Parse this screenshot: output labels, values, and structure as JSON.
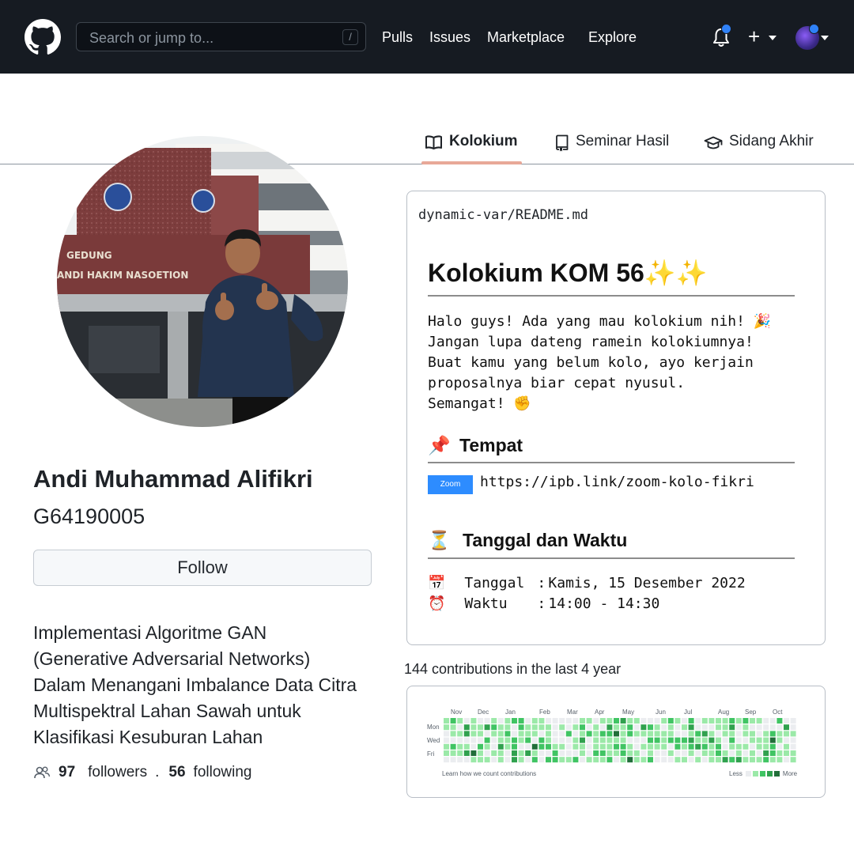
{
  "topbar": {
    "search_placeholder": "Search or jump to...",
    "search_shortcut": "/",
    "nav": [
      "Pulls",
      "Issues",
      "Marketplace",
      "Explore"
    ],
    "plus_label": "+",
    "colors": {
      "bg": "#161b22",
      "notification_dot": "#2f81f7"
    }
  },
  "tabs": [
    {
      "label": "Kolokium",
      "icon": "book-icon",
      "active": true
    },
    {
      "label": "Seminar Hasil",
      "icon": "repo-icon",
      "active": false
    },
    {
      "label": "Sidang Akhir",
      "icon": "mortarboard-icon",
      "active": false
    }
  ],
  "profile": {
    "name": "Andi Muhammad Alifikri",
    "nim": "G64190005",
    "follow_label": "Follow",
    "bio": [
      "Implementasi Algoritme GAN",
      "(Generative Adversarial Networks)",
      "Dalam Menangani Imbalance Data Citra",
      "Multispektral Lahan Sawah untuk",
      "Klasifikasi Kesuburan Lahan"
    ],
    "followers_count": "97",
    "followers_label": "followers",
    "separator": ".",
    "following_count": "56",
    "following_label": "following",
    "photo_sign_text": [
      "GEDUNG",
      "ANDI HAKIM NASOETION"
    ]
  },
  "readme": {
    "path": "dynamic-var/README.md",
    "title": "Kolokium KOM 56",
    "title_emoji": "✨✨",
    "intro": [
      "Halo guys! Ada yang mau kolokium nih! 🎉",
      "Jangan lupa dateng ramein kolokiumnya!",
      "Buat kamu yang belum kolo, ayo kerjain",
      "proposalnya biar cepat nyusul.",
      "Semangat! ✊"
    ],
    "place_heading": "Tempat",
    "place_emoji": "📌",
    "zoom_badge": "Zoom",
    "zoom_url": "https://ipb.link/zoom-kolo-fikri",
    "datetime_heading": "Tanggal dan Waktu",
    "datetime_emoji": "⏳",
    "date_emoji": "📅",
    "date_label": "Tanggal",
    "date_value": "Kamis, 15 Desember 2022",
    "time_emoji": "⏰",
    "time_label": "Waktu",
    "time_value": "14:00 - 14:30",
    "colon": ":"
  },
  "contributions": {
    "summary": "144 contributions in the last 4 year",
    "months": [
      "Nov",
      "Dec",
      "Jan",
      "Feb",
      "Mar",
      "Apr",
      "May",
      "Jun",
      "Jul",
      "Aug",
      "Sep",
      "Oct"
    ],
    "days": [
      "Mon",
      "Wed",
      "Fri"
    ],
    "footer_link": "Learn how we count contributions",
    "legend_less": "Less",
    "legend_more": "More",
    "level_colors": [
      "#ebedf0",
      "#9be9a8",
      "#40c463",
      "#30a14e",
      "#216e39"
    ]
  }
}
